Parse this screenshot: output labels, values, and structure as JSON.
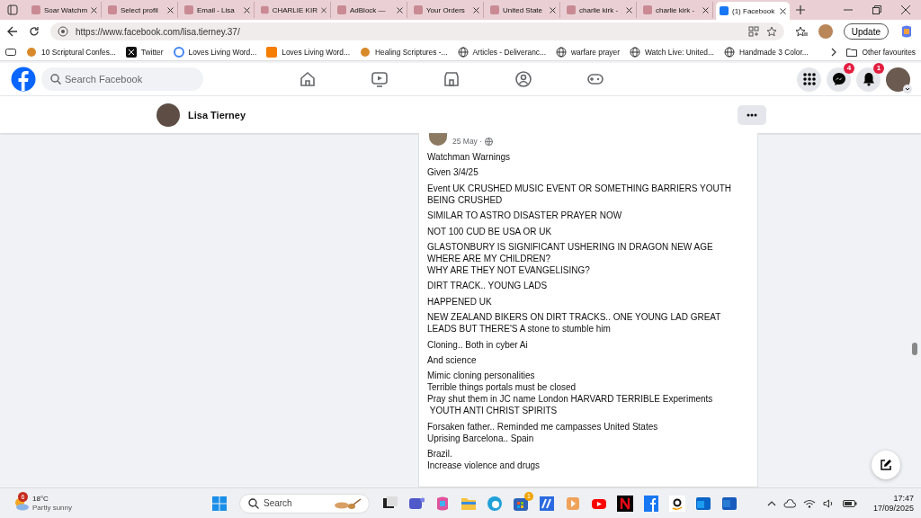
{
  "browser": {
    "tabs": [
      {
        "title": "Soar Watchm",
        "selected": false
      },
      {
        "title": "Select profil",
        "selected": false
      },
      {
        "title": "Email - Lisa",
        "selected": false
      },
      {
        "title": "CHARLIE KIR",
        "selected": false
      },
      {
        "title": "AdBlock — ",
        "selected": false
      },
      {
        "title": "Your Orders",
        "selected": false
      },
      {
        "title": "United State",
        "selected": false
      },
      {
        "title": "charlie kirk -",
        "selected": false
      },
      {
        "title": "charlie kirk -",
        "selected": false
      },
      {
        "title": "(1) Facebook",
        "selected": true
      }
    ],
    "url": "https://www.facebook.com/lisa.tierney.37/",
    "update_label": "Update",
    "bookmarks": [
      {
        "label": "10 Scriptural Confes..."
      },
      {
        "label": "Twitter"
      },
      {
        "label": "Loves Living Word..."
      },
      {
        "label": "Loves Living Word..."
      },
      {
        "label": "Healing Scriptures -..."
      },
      {
        "label": "Articles - Deliveranc..."
      },
      {
        "label": "warfare prayer"
      },
      {
        "label": "Watch Live: United..."
      },
      {
        "label": "Handmade 3 Color..."
      }
    ],
    "other_favourites": "Other favourites"
  },
  "facebook": {
    "search_placeholder": "Search Facebook",
    "messenger_badge": "4",
    "notifications_badge": "1",
    "profile_name": "Lisa Tierney",
    "post": {
      "date": "25 May ·",
      "paragraphs": [
        "Watchman Warnings",
        "Given 3/4/25",
        "Event UK CRUSHED MUSIC EVENT OR SOMETHING BARRIERS YOUTH BEING CRUSHED",
        "SIMILAR TO ASTRO DISASTER PRAYER NOW",
        "NOT 100 CUD BE USA OR UK",
        "GLASTONBURY IS SIGNIFICANT USHERING IN DRAGON NEW AGE\nWHERE ARE MY CHILDREN?\nWHY ARE THEY NOT EVANGELISING?",
        "DIRT TRACK.. YOUNG LADS",
        "HAPPENED UK",
        "NEW ZEALAND BIKERS ON DIRT TRACKS.. ONE YOUNG LAD GREAT LEADS BUT THERE'S A stone to stumble him",
        "Cloning.. Both in cyber Ai",
        "And science",
        "Mimic cloning personalities\nTerrible things portals must be closed\nPray shut them in JC name London HARVARD TERRIBLE Experiments\n YOUTH ANTI CHRIST SPIRITS",
        "Forsaken father.. Reminded me campasses United States\nUprising Barcelona.. Spain",
        "Brazil.\nIncrease violence and drugs"
      ]
    }
  },
  "taskbar": {
    "weather_badge": "6",
    "temperature": "18°C",
    "condition": "Partly sunny",
    "search_placeholder": "Search",
    "store_badge": "1",
    "time": "17:47",
    "date": "17/09/2025"
  }
}
